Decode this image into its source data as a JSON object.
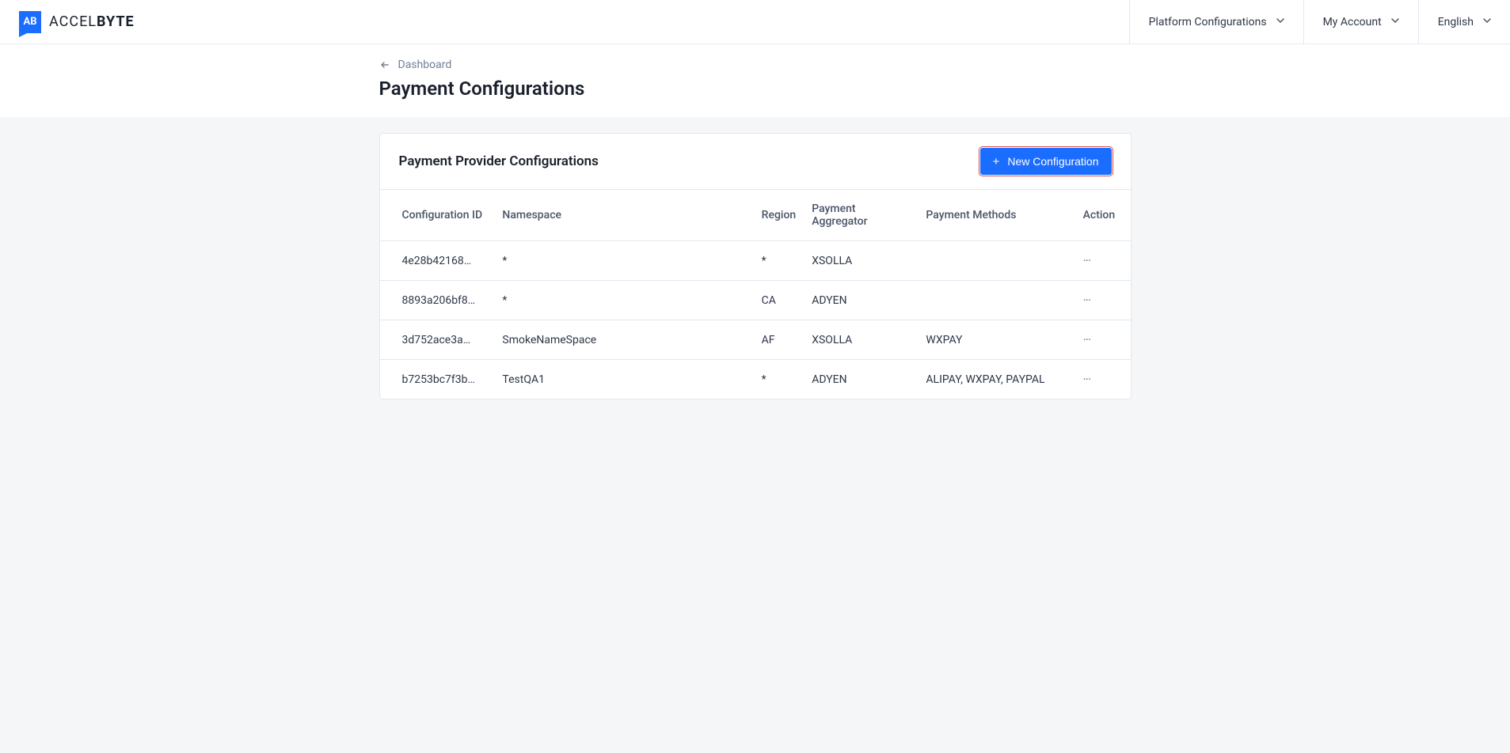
{
  "brand": {
    "name": "ACCELBYTE",
    "icon_text": "AB"
  },
  "header": {
    "platform_config": "Platform Configurations",
    "my_account": "My Account",
    "language": "English"
  },
  "breadcrumb": {
    "link": "Dashboard"
  },
  "page": {
    "title": "Payment Configurations"
  },
  "card": {
    "title": "Payment Provider Configurations",
    "button": "New Configuration"
  },
  "table": {
    "headers": {
      "config_id": "Configuration ID",
      "namespace": "Namespace",
      "region": "Region",
      "aggregator": "Payment Aggregator",
      "methods": "Payment Methods",
      "action": "Action"
    },
    "rows": [
      {
        "config_id": "4e28b42168…",
        "namespace": "*",
        "region": "*",
        "aggregator": "XSOLLA",
        "methods": ""
      },
      {
        "config_id": "8893a206bf8…",
        "namespace": "*",
        "region": "CA",
        "aggregator": "ADYEN",
        "methods": ""
      },
      {
        "config_id": "3d752ace3a…",
        "namespace": "SmokeNameSpace",
        "region": "AF",
        "aggregator": "XSOLLA",
        "methods": "WXPAY"
      },
      {
        "config_id": "b7253bc7f3b…",
        "namespace": "TestQA1",
        "region": "*",
        "aggregator": "ADYEN",
        "methods": "ALIPAY, WXPAY, PAYPAL"
      }
    ]
  }
}
